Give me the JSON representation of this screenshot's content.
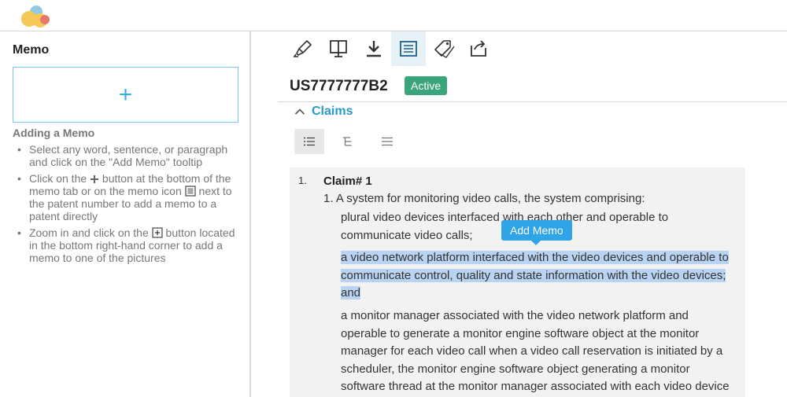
{
  "sidebar": {
    "title": "Memo",
    "add_symbol": "+",
    "help_title": "Adding a Memo",
    "help_items": [
      {
        "text": "Select any word, sentence, or paragraph and click on the \"Add Memo\" tooltip"
      },
      {
        "before": "Click on the ",
        "middle": " button at the bottom of the memo tab or on the memo icon ",
        "after": " next to the patent number to add a memo to a patent directly"
      },
      {
        "before": "Zoom in and click on the ",
        "after": " button located in the bottom right-hand corner to add a memo to one of the pictures"
      }
    ]
  },
  "toolbar": {
    "icons": [
      "highlighter-icon",
      "compare-icon",
      "download-icon",
      "memo-icon",
      "tags-icon",
      "export-icon"
    ],
    "active_index": 3
  },
  "patent": {
    "number": "US7777777B2",
    "status": "Active",
    "status_color": "#3aa57a"
  },
  "claims": {
    "title": "Claims",
    "accent_color": "#2a9ac7",
    "view_modes": [
      "list-view-icon",
      "tree-view-icon",
      "plain-view-icon"
    ],
    "item_number": "1.",
    "heading": "Claim# 1",
    "intro": "1. A system for monitoring video calls, the system comprising:",
    "clauses": [
      {
        "lines": [
          "plural video devices interfaced with each other and operable to",
          "communicate video calls;"
        ]
      },
      {
        "lines": [
          "a video network platform interfaced with the video devices and operable to",
          "communicate control, quality and state information with the video devices;",
          "and"
        ]
      },
      {
        "lines": [
          "a monitor manager associated with the video network platform and",
          "operable to generate a monitor engine software object at the monitor",
          "manager for each video call when a video call reservation is initiated by a",
          "scheduler, the monitor engine software object generating a monitor",
          "software thread at the monitor manager associated with each video device"
        ]
      }
    ]
  },
  "tooltip": {
    "label": "Add Memo"
  }
}
